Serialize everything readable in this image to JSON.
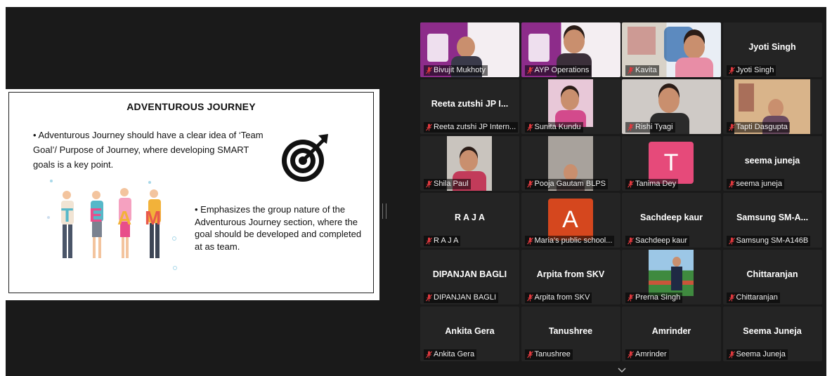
{
  "slide": {
    "title": "ADVENTUROUS JOURNEY",
    "bullet1": "• Adventurous Journey should have a clear idea of ‘Team Goal’/ Purpose of Journey, where developing SMART goals is a key point.",
    "bullet2": "• Emphasizes the group nature of the Adventurous Journey section, where the goal should be developed and completed at as team.",
    "team_letters": [
      "T",
      "E",
      "A",
      "M"
    ],
    "colors": {
      "team1": "#56b8c9",
      "team2": "#e84e8a",
      "team3": "#f2b23a",
      "team4": "#e9594b"
    }
  },
  "gallery": {
    "colors": {
      "active_border": "#32c97a",
      "tile_bg": "#242424",
      "mute": "#e0393e",
      "avatar_pink": "#e64a7a",
      "avatar_orange": "#d5471e"
    },
    "tiles": [
      {
        "name": "Bivujit Mukhoty",
        "kind": "video"
      },
      {
        "name": "AYP Operations",
        "kind": "video"
      },
      {
        "name": "Kavita",
        "kind": "video"
      },
      {
        "name": "Jyoti Singh",
        "display": "Jyoti Singh",
        "kind": "name"
      },
      {
        "name": "Reeta zutshi JP Intern...",
        "display": "Reeta zutshi JP I...",
        "kind": "name"
      },
      {
        "name": "Sunita Kundu",
        "kind": "video"
      },
      {
        "name": "Rishi Tyagi",
        "kind": "video"
      },
      {
        "name": "Tapti Dasgupta",
        "kind": "video"
      },
      {
        "name": "Shila Paul",
        "kind": "video"
      },
      {
        "name": "Pooja Gautam BLPS",
        "kind": "video"
      },
      {
        "name": "Tanima Dey",
        "avatar": "T",
        "kind": "avatar"
      },
      {
        "name": "seema juneja",
        "display": "seema juneja",
        "kind": "name"
      },
      {
        "name": "R A J A",
        "display": "R A J A",
        "kind": "name"
      },
      {
        "name": "Maria's public school...",
        "avatar": "A",
        "kind": "avatar"
      },
      {
        "name": "Sachdeep kaur",
        "display": "Sachdeep kaur",
        "kind": "name"
      },
      {
        "name": "Samsung SM-A146B",
        "display": "Samsung  SM-A...",
        "kind": "name"
      },
      {
        "name": "DIPANJAN BAGLI",
        "display": "DIPANJAN BAGLI",
        "kind": "name"
      },
      {
        "name": "Arpita from SKV",
        "display": "Arpita from SKV",
        "kind": "name"
      },
      {
        "name": "Prerna Singh",
        "kind": "video"
      },
      {
        "name": "Chittaranjan",
        "display": "Chittaranjan",
        "kind": "name"
      },
      {
        "name": "Ankita Gera",
        "display": "Ankita Gera",
        "kind": "name"
      },
      {
        "name": "Tanushree",
        "display": "Tanushree",
        "kind": "name"
      },
      {
        "name": "Amrinder",
        "display": "Amrinder",
        "kind": "name"
      },
      {
        "name": "Seema Juneja",
        "display": "Seema Juneja",
        "kind": "name"
      }
    ]
  },
  "icons": {
    "mic": "mic-muted-icon",
    "more": "chevron-down-icon",
    "target": "target-icon"
  }
}
